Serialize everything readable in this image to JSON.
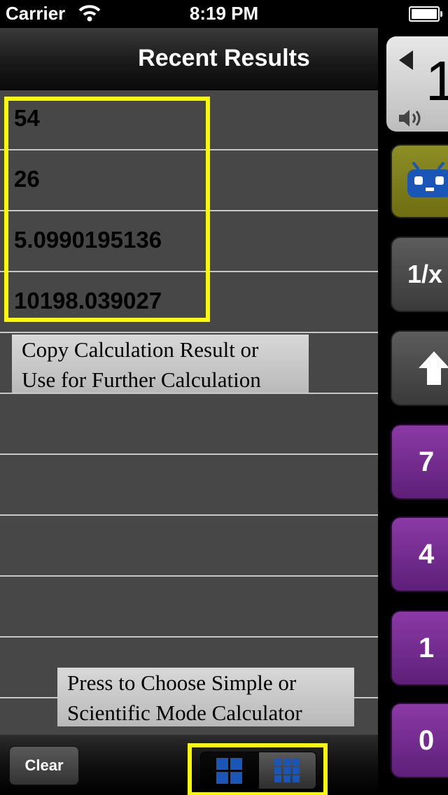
{
  "status_bar": {
    "carrier": "Carrier",
    "time": "8:19 PM"
  },
  "header": {
    "title": "Recent Results"
  },
  "results": [
    "54",
    "26",
    "5.0990195136",
    "10198.039027",
    "",
    "",
    "",
    "",
    "",
    ""
  ],
  "tooltips": {
    "copy_line1": "Copy Calculation Result or",
    "copy_line2": "Use for Further Calculation",
    "mode_line1": "Press to Choose Simple or",
    "mode_line2": "Scientific Mode Calculator"
  },
  "toolbar": {
    "clear_label": "Clear"
  },
  "keypad": {
    "display_value": "1",
    "inverse_label": "1/x",
    "keys": [
      "7",
      "4",
      "1",
      "0"
    ]
  },
  "colors": {
    "highlight": "#f8f808",
    "number_key": "#7a2e96",
    "robot_key": "#7f7f1c",
    "mode_icon_blue": "#1a56b8"
  }
}
